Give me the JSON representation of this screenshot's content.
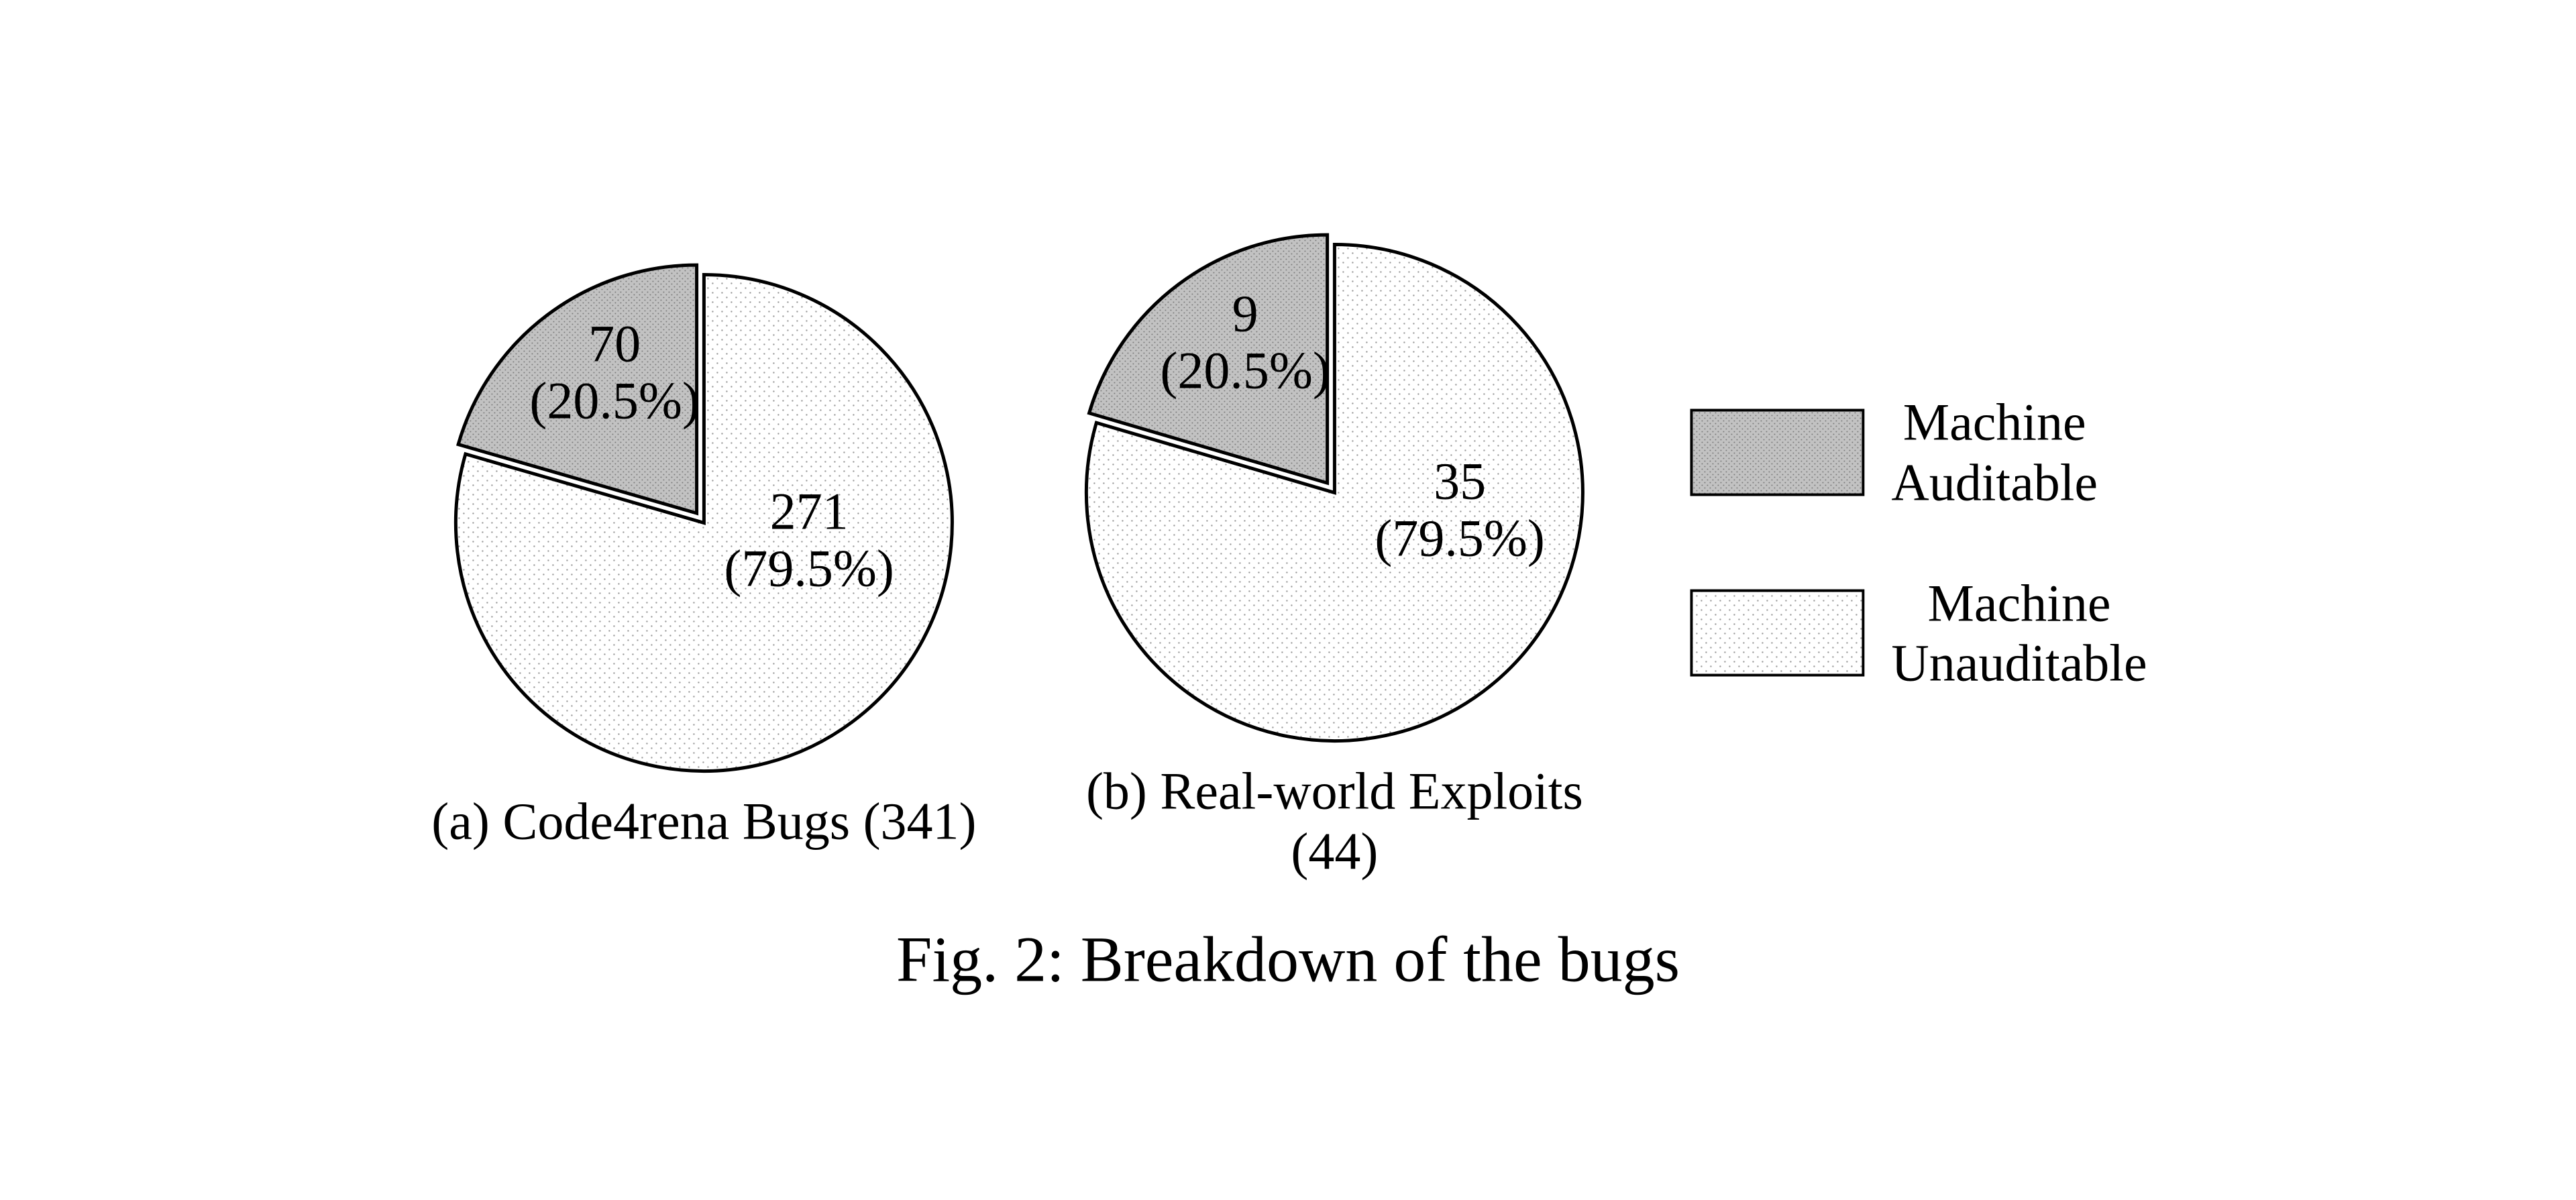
{
  "caption": "Fig. 2: Breakdown of the bugs",
  "legend": {
    "auditable": "Machine\nAuditable",
    "unauditable": "Machine\nUnauditable"
  },
  "chart_a": {
    "subcaption": "(a) Code4rena Bugs (341)",
    "slice_auditable_label": "70\n(20.5%)",
    "slice_unauditable_label": "271\n(79.5%)"
  },
  "chart_b": {
    "subcaption": "(b) Real-world Exploits (44)",
    "slice_auditable_label": "9\n(20.5%)",
    "slice_unauditable_label": "35\n(79.5%)"
  },
  "chart_data": [
    {
      "type": "pie",
      "title": "(a) Code4rena Bugs (341)",
      "total": 341,
      "series": [
        {
          "name": "Machine Auditable",
          "value": 70,
          "percent": 20.5
        },
        {
          "name": "Machine Unauditable",
          "value": 271,
          "percent": 79.5
        }
      ]
    },
    {
      "type": "pie",
      "title": "(b) Real-world Exploits (44)",
      "total": 44,
      "series": [
        {
          "name": "Machine Auditable",
          "value": 9,
          "percent": 20.5
        },
        {
          "name": "Machine Unauditable",
          "value": 35,
          "percent": 79.5
        }
      ]
    }
  ],
  "style": {
    "auditable_fill": "#c2c2c2",
    "unauditable_fill": "#ffffff",
    "stroke": "#000000",
    "auditable_offset": 18
  }
}
